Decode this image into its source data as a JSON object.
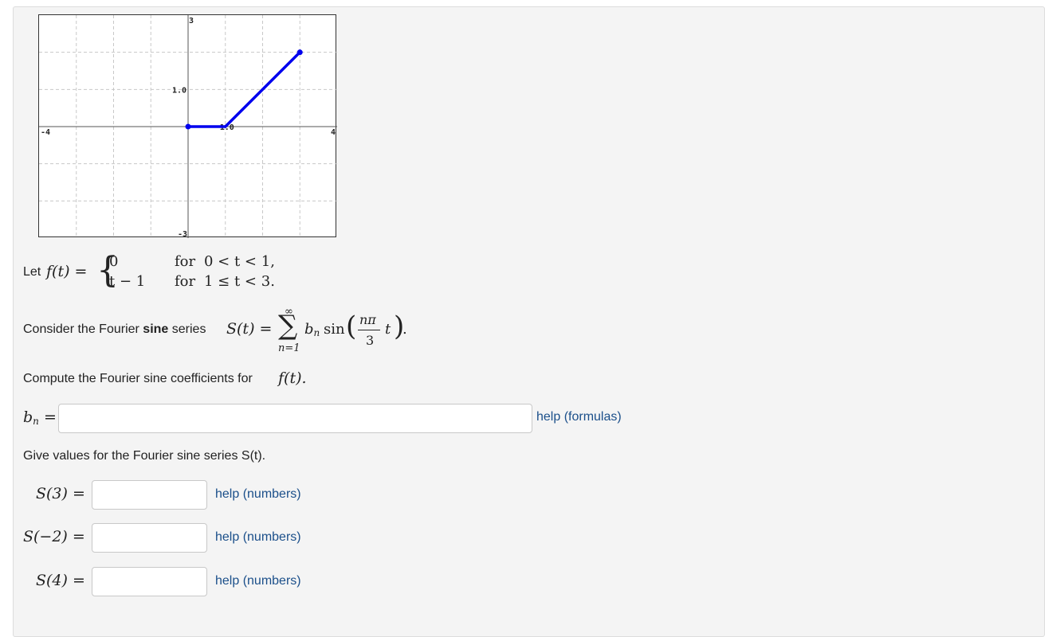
{
  "graph": {
    "labels": {
      "ymax": "3",
      "ymid": "1.0",
      "xmid": "1.0",
      "xmin": "-4",
      "xmax": "4",
      "ymin": "-3"
    },
    "xlim": [
      -4,
      4
    ],
    "ylim": [
      -3,
      3
    ],
    "grid_step": 1,
    "line_color": "#0000ee",
    "segments": [
      {
        "from": [
          0,
          0
        ],
        "to": [
          1,
          0
        ]
      },
      {
        "from": [
          1,
          0
        ],
        "to": [
          3,
          2
        ]
      }
    ]
  },
  "problem": {
    "let_label": "Let",
    "f_lhs": "f(t) =",
    "case1_value": "0",
    "case1_cond_for": "for",
    "case1_cond": "0 < t < 1,",
    "case2_value": "t − 1",
    "case2_cond_for": "for",
    "case2_cond": "1 ≤ t < 3.",
    "consider_prefix": "Consider the Fourier ",
    "consider_bold": "sine",
    "consider_suffix": " series ",
    "series_lhs": "S(t) =",
    "sum_top": "∞",
    "sum_bottom": "n=1",
    "series_term_b": "b",
    "series_term_n": "n",
    "series_sin": "sin",
    "frac_num": "nπ",
    "frac_den": "3",
    "series_t": "t",
    "compute_text": "Compute the Fourier sine coefficients for ",
    "compute_fx": "f(t).",
    "give_text": "Give values for the Fourier sine series S(t)."
  },
  "bn_field": {
    "label_b": "b",
    "label_n": "n",
    "label_eq": "=",
    "value": "",
    "help": "help (formulas)"
  },
  "s_fields": [
    {
      "label": "S(3) =",
      "value": "",
      "help": "help (numbers)"
    },
    {
      "label": "S(−2) =",
      "value": "",
      "help": "help (numbers)"
    },
    {
      "label": "S(4) =",
      "value": "",
      "help": "help (numbers)"
    }
  ]
}
